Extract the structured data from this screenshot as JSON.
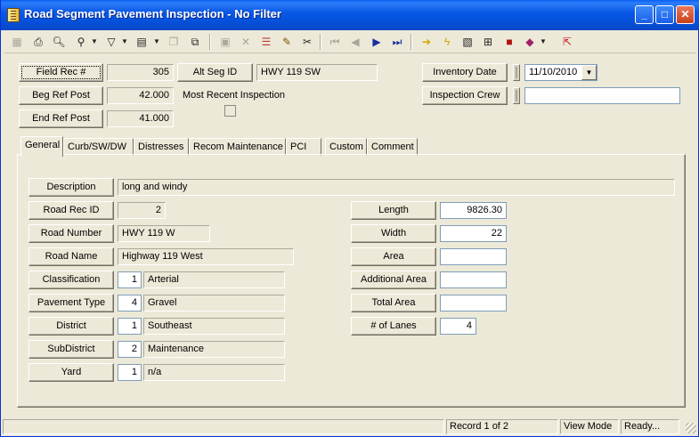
{
  "window": {
    "title": "Road Segment Pavement Inspection - No Filter"
  },
  "titlebar_buttons": [
    "minimize-icon",
    "maximize-icon",
    "close-icon"
  ],
  "toolbar": {
    "icons": [
      "new-record-icon",
      "print-icon",
      "print-preview-icon",
      "find-icon",
      "filter-icon",
      "view-icon",
      "copy-record-icon",
      "duplicate-icon",
      "save-icon",
      "delete-icon",
      "stack-icon",
      "edit-pencil-icon",
      "cut-icon",
      "first-record-icon",
      "previous-record-icon",
      "next-record-icon",
      "last-record-icon",
      "goto-icon",
      "lightning-icon",
      "map-icon",
      "tree-icon",
      "truck-icon",
      "book-icon",
      "exit-icon"
    ]
  },
  "header": {
    "field_rec_label": "Field Rec #",
    "field_rec_value": "305",
    "alt_seg_label": "Alt Seg ID",
    "alt_seg_value": "HWY 119 SW",
    "inventory_date_label": "Inventory Date",
    "inventory_date_value": "11/10/2010",
    "beg_ref_label": "Beg Ref Post",
    "beg_ref_value": "42.000",
    "most_recent_label": "Most Recent Inspection",
    "inspection_crew_label": "Inspection Crew",
    "inspection_crew_value": "",
    "end_ref_label": "End Ref Post",
    "end_ref_value": "41.000"
  },
  "tabs": [
    "General",
    "Curb/SW/DW",
    "Distresses",
    "Recom Maintenance",
    "PCI",
    "Custom",
    "Comment"
  ],
  "general": {
    "description_label": "Description",
    "description_value": "long and windy",
    "road_rec_label": "Road Rec ID",
    "road_rec_value": "2",
    "road_number_label": "Road Number",
    "road_number_value": "HWY 119 W",
    "road_name_label": "Road Name",
    "road_name_value": "Highway 119 West",
    "classification_label": "Classification",
    "classification_code": "1",
    "classification_value": "Arterial",
    "pavement_type_label": "Pavement Type",
    "pavement_type_code": "4",
    "pavement_type_value": "Gravel",
    "district_label": "District",
    "district_code": "1",
    "district_value": "Southeast",
    "subdistrict_label": "SubDistrict",
    "subdistrict_code": "2",
    "subdistrict_value": "Maintenance",
    "yard_label": "Yard",
    "yard_code": "1",
    "yard_value": "n/a",
    "length_label": "Length",
    "length_value": "9826.30",
    "width_label": "Width",
    "width_value": "22",
    "area_label": "Area",
    "area_value": "",
    "additional_area_label": "Additional Area",
    "additional_area_value": "",
    "total_area_label": "Total Area",
    "total_area_value": "",
    "lanes_label": "# of Lanes",
    "lanes_value": "4"
  },
  "status": {
    "record": "Record 1 of 2",
    "mode": "View Mode",
    "state": "Ready..."
  }
}
